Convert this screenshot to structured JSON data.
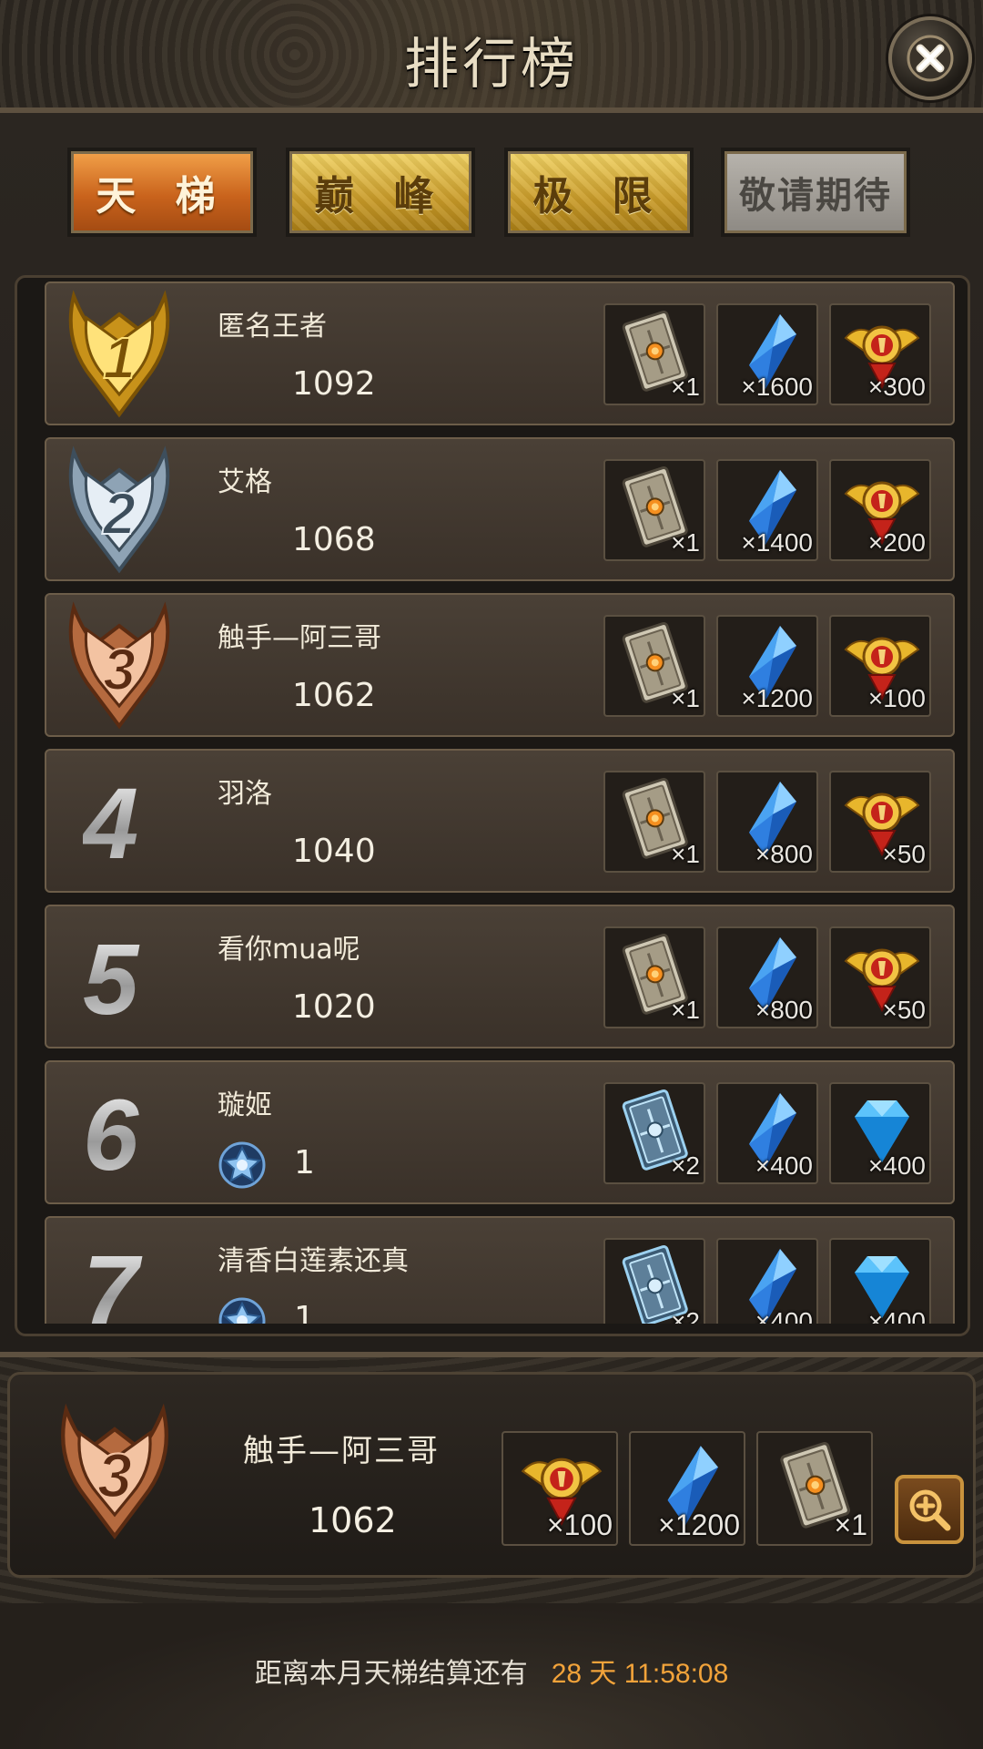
{
  "header": {
    "title": "排行榜",
    "close_icon": "close-icon"
  },
  "tabs": [
    {
      "label": "天 梯",
      "state": "active"
    },
    {
      "label": "巅 峰",
      "state": "gold"
    },
    {
      "label": "极 限",
      "state": "gold"
    },
    {
      "label": "敬请期待",
      "state": "disabled"
    }
  ],
  "rankings": [
    {
      "rank": "1",
      "name": "匿名王者",
      "score": "1092",
      "rewards": [
        {
          "icon": "card-icon",
          "qty": "×1"
        },
        {
          "icon": "crystal-icon",
          "qty": "×1600"
        },
        {
          "icon": "gold-medal-icon",
          "qty": "×300"
        }
      ]
    },
    {
      "rank": "2",
      "name": "艾格",
      "score": "1068",
      "rewards": [
        {
          "icon": "card-icon",
          "qty": "×1"
        },
        {
          "icon": "crystal-icon",
          "qty": "×1400"
        },
        {
          "icon": "gold-medal-icon",
          "qty": "×200"
        }
      ]
    },
    {
      "rank": "3",
      "name": "触手—阿三哥",
      "score": "1062",
      "rewards": [
        {
          "icon": "card-icon",
          "qty": "×1"
        },
        {
          "icon": "crystal-icon",
          "qty": "×1200"
        },
        {
          "icon": "gold-medal-icon",
          "qty": "×100"
        }
      ]
    },
    {
      "rank": "4",
      "name": "羽洛",
      "score": "1040",
      "rewards": [
        {
          "icon": "card-icon",
          "qty": "×1"
        },
        {
          "icon": "crystal-icon",
          "qty": "×800"
        },
        {
          "icon": "gold-medal-icon",
          "qty": "×50"
        }
      ]
    },
    {
      "rank": "5",
      "name": "看你mua呢",
      "score": "1020",
      "rewards": [
        {
          "icon": "card-icon",
          "qty": "×1"
        },
        {
          "icon": "crystal-icon",
          "qty": "×800"
        },
        {
          "icon": "gold-medal-icon",
          "qty": "×50"
        }
      ]
    },
    {
      "rank": "6",
      "name": "璇姬",
      "score": "1",
      "rewards": [
        {
          "icon": "silver-card-icon",
          "qty": "×2"
        },
        {
          "icon": "crystal-icon",
          "qty": "×400"
        },
        {
          "icon": "diamond-icon",
          "qty": "×400"
        }
      ]
    },
    {
      "rank": "7",
      "name": "清香白莲素还真",
      "score": "1",
      "rewards": [
        {
          "icon": "silver-card-icon",
          "qty": "×2"
        },
        {
          "icon": "crystal-icon",
          "qty": "×400"
        },
        {
          "icon": "diamond-icon",
          "qty": "×400"
        }
      ]
    }
  ],
  "my_rank": {
    "rank": "3",
    "name": "触手—阿三哥",
    "score": "1062",
    "rewards": [
      {
        "icon": "gold-medal-icon",
        "qty": "×100"
      },
      {
        "icon": "crystal-icon",
        "qty": "×1200"
      },
      {
        "icon": "card-icon",
        "qty": "×1"
      }
    ],
    "zoom_icon": "zoom-in-icon"
  },
  "footer": {
    "countdown_label": "距离本月天梯结算还有",
    "countdown_value": "28 天 11:58:08"
  },
  "colors": {
    "accent_orange": "#f2a33a",
    "tab_active": "#d9762b",
    "tab_gold": "#e0b840",
    "bronze": "#c9825a"
  }
}
